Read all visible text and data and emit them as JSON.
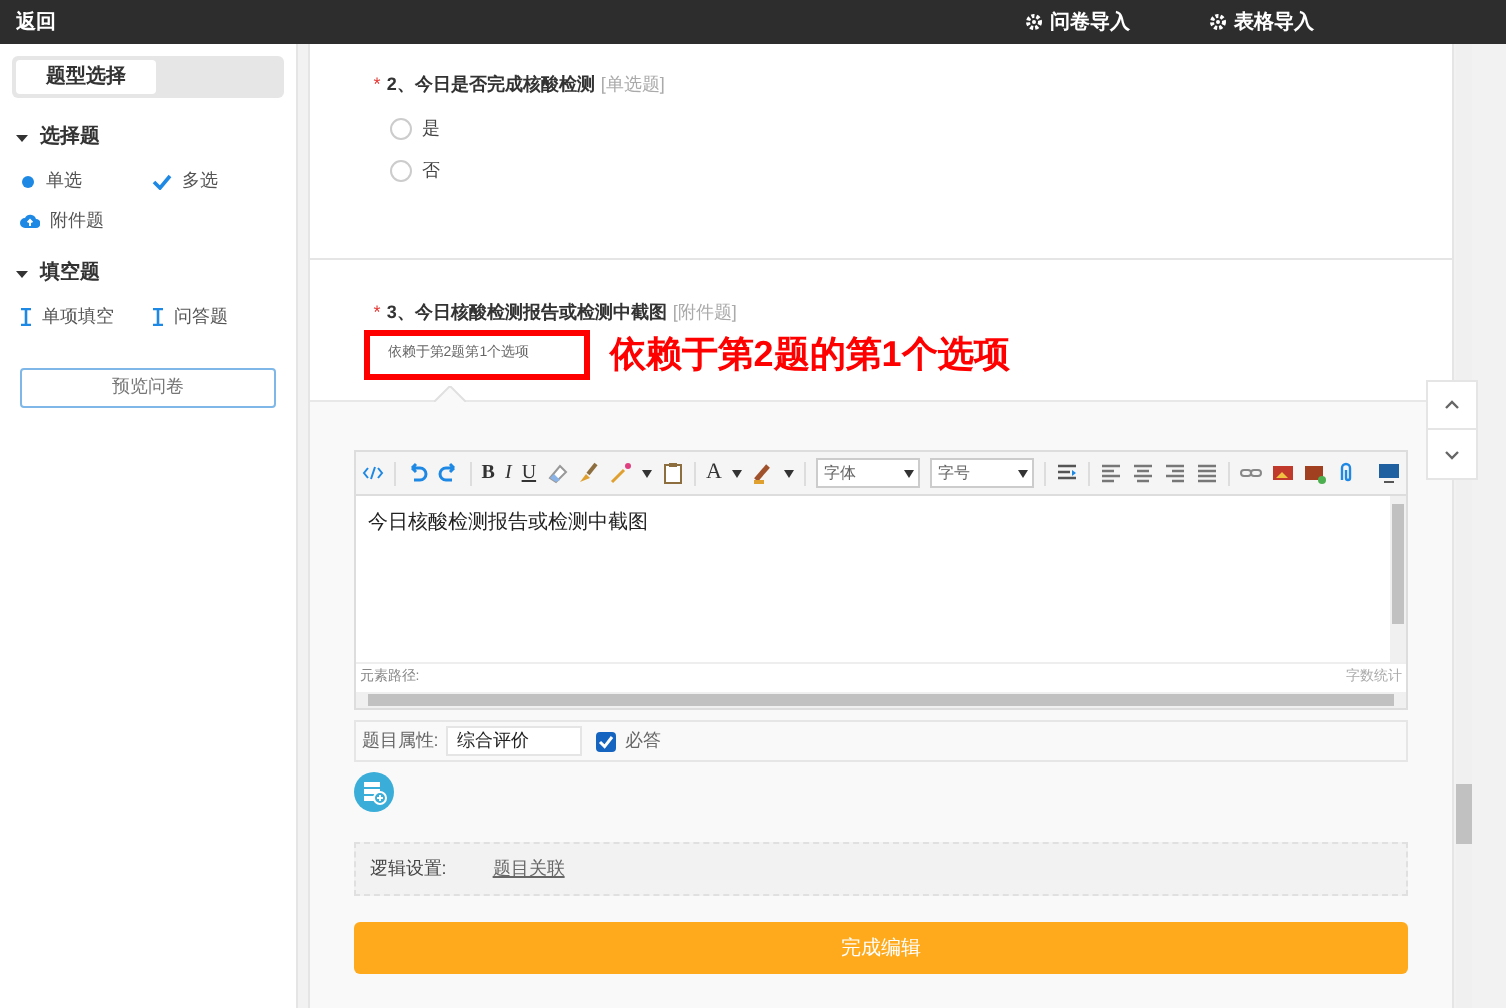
{
  "top_bar": {
    "back": "返回",
    "actions": [
      "问卷导入",
      "表格导入"
    ]
  },
  "sidebar": {
    "tabs": [
      {
        "label": "题型选择",
        "selected": true
      }
    ],
    "groups": [
      {
        "title": "选择题",
        "expanded": true,
        "items": [
          {
            "label": "单选",
            "kind": "dot"
          },
          {
            "label": "多选",
            "kind": "check"
          },
          {
            "label": "附件题",
            "kind": "cloud"
          }
        ]
      },
      {
        "title": "填空题",
        "expanded": true,
        "items": [
          {
            "label": "单项填空",
            "kind": "cursor"
          },
          {
            "label": "问答题",
            "kind": "cursor"
          }
        ]
      }
    ],
    "preview_button": "预览问卷"
  },
  "questions": [
    {
      "required": "*",
      "title": "2、今日是否完成核酸检测",
      "type": "[单选题]",
      "options": [
        {
          "label": "是",
          "selected": false
        },
        {
          "label": "否",
          "selected": false
        }
      ]
    },
    {
      "required": "*",
      "title": "3、今日核酸检测报告或检测中截图",
      "type": "[附件题]",
      "dependency": "依赖于第2题第1个选项"
    }
  ],
  "annotation": "依赖于第2题的第1个选项",
  "editor": {
    "toolbar_letters": [
      "B",
      "I",
      "U",
      "A"
    ],
    "font_select": "字体",
    "size_select": "字号",
    "content": "今日核酸检测报告或检测中截图",
    "path_label": "元素路径:",
    "word_count": "字数统计"
  },
  "attributes": {
    "label": "题目属性:",
    "value": "综合评价",
    "required_label": "必答",
    "required_checked": true
  },
  "logic": {
    "label": "逻辑设置:",
    "link": "题目关联"
  },
  "finish_button": "完成编辑"
}
